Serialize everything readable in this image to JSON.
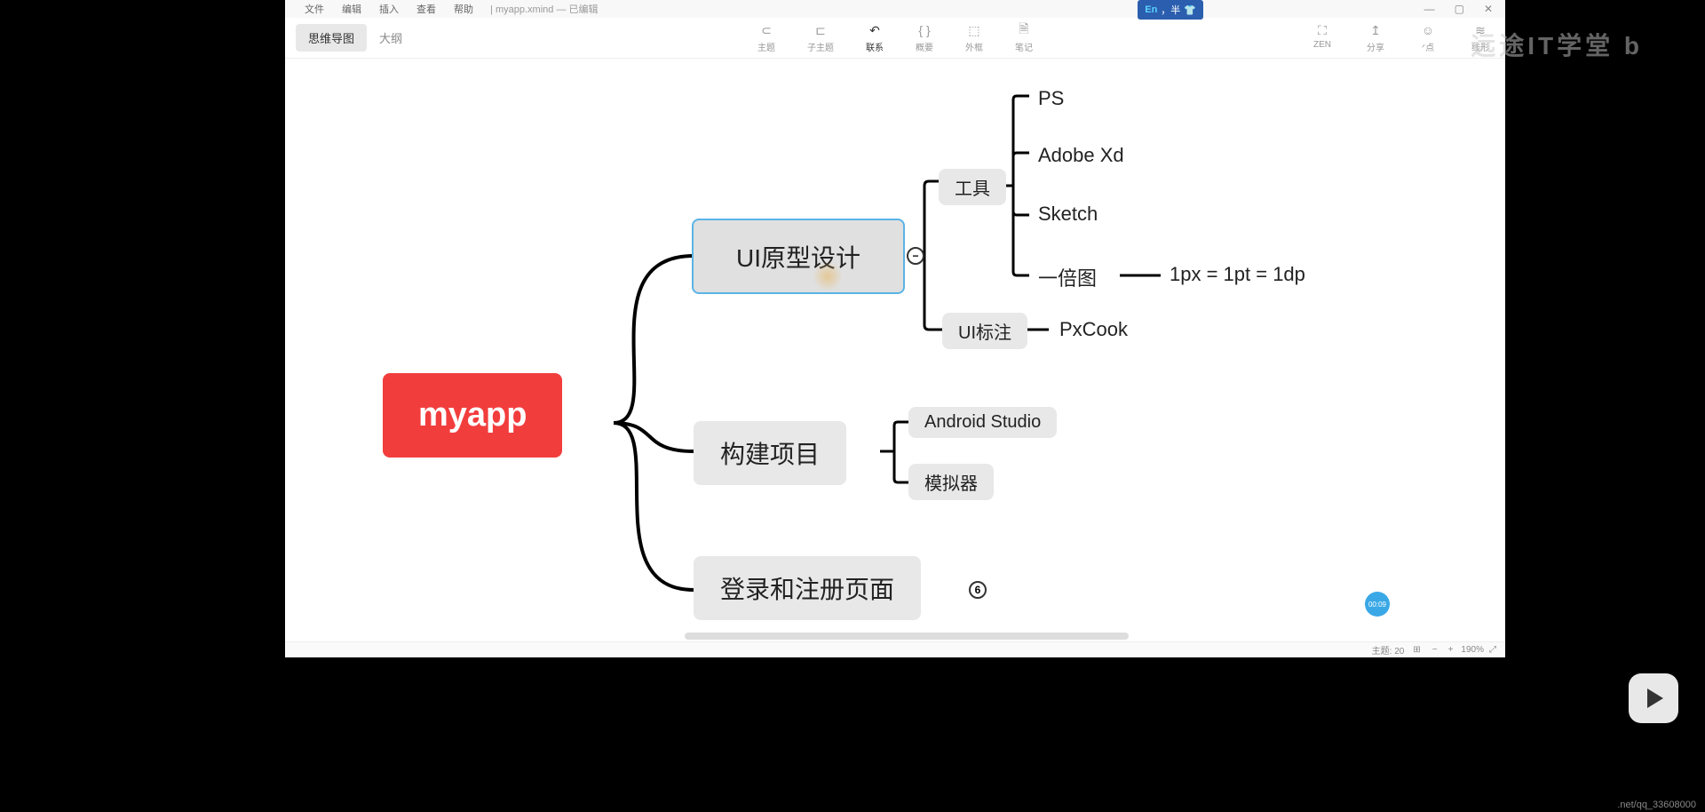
{
  "menus": [
    "文件",
    "编辑",
    "插入",
    "查看",
    "帮助"
  ],
  "doc": {
    "filename": "myapp.xmind",
    "status": "已编辑"
  },
  "ime": {
    "lang": "En",
    "mode": "，半"
  },
  "tabs": [
    {
      "label": "思维导图",
      "active": true
    },
    {
      "label": "大纲",
      "active": false
    }
  ],
  "toolbar": [
    {
      "label": "主题",
      "glyph": "⊂"
    },
    {
      "label": "子主题",
      "glyph": "⊏"
    },
    {
      "label": "联系",
      "glyph": "↶",
      "active": true
    },
    {
      "label": "概要",
      "glyph": "{ }"
    },
    {
      "label": "外框",
      "glyph": "⬚"
    },
    {
      "label": "笔记",
      "glyph": "🗎"
    }
  ],
  "toolbar_right": [
    {
      "label": "ZEN",
      "glyph": "⛶"
    },
    {
      "label": "分享",
      "glyph": "↥"
    },
    {
      "label": "ᐟ点",
      "glyph": "☺"
    },
    {
      "label": "线形",
      "glyph": "≋"
    }
  ],
  "mindmap": {
    "root": "myapp",
    "branches": [
      {
        "label": "UI原型设计",
        "selected": true,
        "collapse": "−",
        "children": [
          {
            "label": "工具",
            "children": [
              "PS",
              "Adobe Xd",
              "Sketch",
              {
                "label": "一倍图",
                "children": [
                  "1px = 1pt = 1dp"
                ]
              }
            ]
          },
          {
            "label": "UI标注",
            "children": [
              "PxCook"
            ]
          }
        ]
      },
      {
        "label": "构建项目",
        "children": [
          {
            "label": "Android Studio"
          },
          {
            "label": "模拟器"
          }
        ]
      },
      {
        "label": "登录和注册页面",
        "collapse": "6"
      }
    ]
  },
  "status": {
    "topics_label": "主题:",
    "topics": "20",
    "zoom": "190%"
  },
  "timer": "00:09",
  "footer_url": ".net/qq_33608000",
  "watermark": "远途IT学堂 b"
}
